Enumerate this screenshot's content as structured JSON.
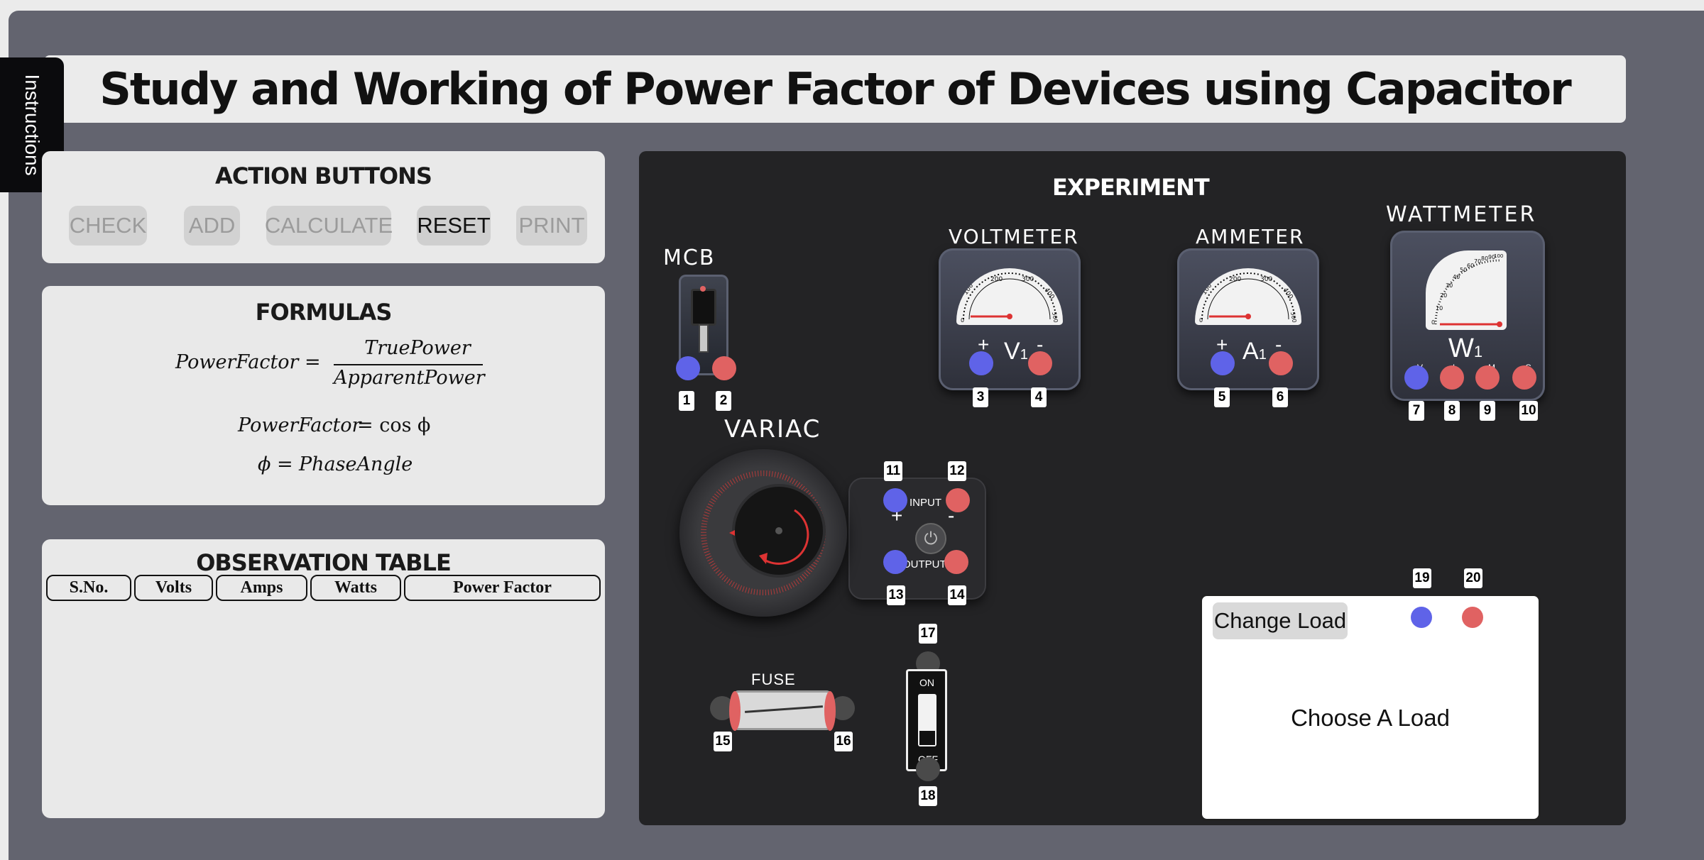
{
  "title": "Study and Working of Power Factor of Devices using Capacitor",
  "instructions_tab": "Instructions",
  "action_panel": {
    "title": "ACTION BUTTONS",
    "buttons": {
      "check": "CHECK",
      "add": "ADD",
      "calculate": "CALCULATE",
      "reset": "RESET",
      "print": "PRINT"
    }
  },
  "formulas": {
    "title": "FORMULAS",
    "line1_lhs": "PowerFactor =",
    "line1_num": "TruePower",
    "line1_den": "ApparentPower",
    "line2_lhs": "PowerFactor",
    "line2_rhs": "= cos ϕ",
    "line3_lhs": "ϕ =",
    "line3_rhs": "PhaseAngle"
  },
  "observation": {
    "title": "OBSERVATION TABLE",
    "columns": [
      "S.No.",
      "Volts",
      "Amps",
      "Watts",
      "Power Factor"
    ]
  },
  "experiment": {
    "title": "EXPERIMENT",
    "mcb": "MCB",
    "voltmeter": "VOLTMETER",
    "ammeter": "AMMETER",
    "wattmeter": "WATTMETER",
    "variac": "VARIAC",
    "fuse": "FUSE",
    "switch_on": "ON",
    "switch_off": "OFF",
    "variac_input": "INPUT",
    "variac_output": "OUTPUT",
    "plus": "+",
    "minus": "-",
    "v_symbol": "V",
    "v_sub": "1",
    "a_symbol": "A",
    "a_sub": "1",
    "w_symbol": "W",
    "w_sub": "1",
    "wattmeter_terminals": [
      "V",
      "L",
      "M",
      "C"
    ],
    "meter_scale_va": [
      "0",
      "100",
      "200",
      "300",
      "400",
      "500"
    ],
    "meter_scale_w": [
      "0",
      "10",
      "20",
      "30",
      "40",
      "50",
      "60",
      "70",
      "80",
      "90",
      "100"
    ],
    "terminal_numbers": [
      "1",
      "2",
      "3",
      "4",
      "5",
      "6",
      "7",
      "8",
      "9",
      "10",
      "11",
      "12",
      "13",
      "14",
      "15",
      "16",
      "17",
      "18",
      "19",
      "20"
    ],
    "change_load": "Change Load",
    "choose_load": "Choose A Load"
  },
  "colors": {
    "terminal_positive": "#5f63e8",
    "terminal_negative": "#e06262",
    "background": "#63646f",
    "experiment_bg": "#232325"
  }
}
